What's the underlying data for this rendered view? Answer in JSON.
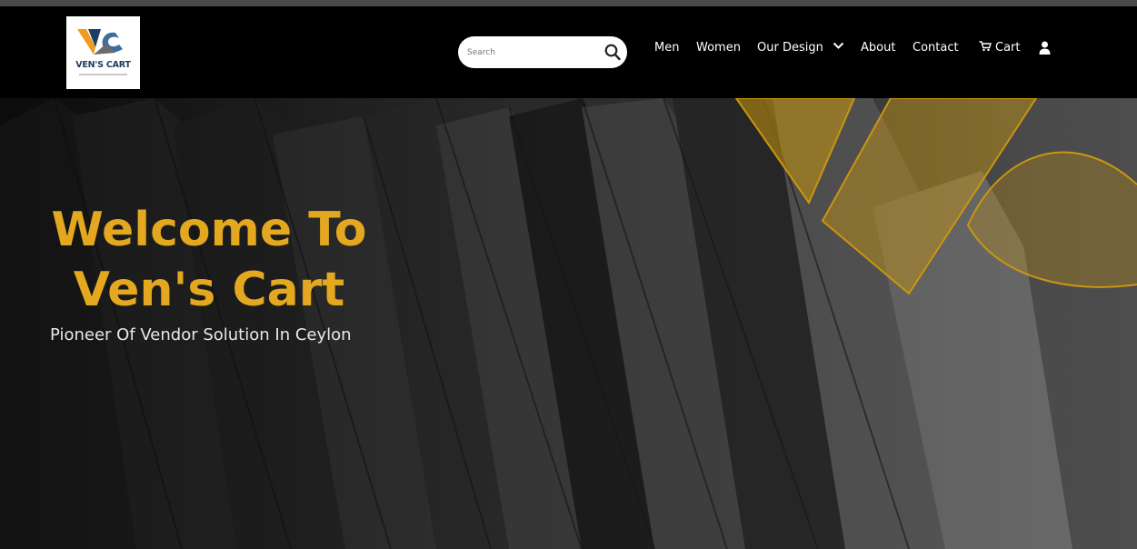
{
  "header": {
    "logo_text": "VEN'S CART",
    "search": {
      "placeholder": "Search"
    },
    "nav": {
      "men": "Men",
      "women": "Women",
      "our_design": "Our Design",
      "about": "About",
      "contact": "Contact",
      "cart": "Cart"
    }
  },
  "hero": {
    "title_line1": "Welcome To",
    "title_line2": "Ven's Cart",
    "subtitle": "Pioneer Of Vendor Solution In Ceylon"
  },
  "colors": {
    "accent": "#e3a820",
    "logo_blue": "#1d3e63",
    "logo_orange": "#f29a1f",
    "navbar": "#000000"
  }
}
